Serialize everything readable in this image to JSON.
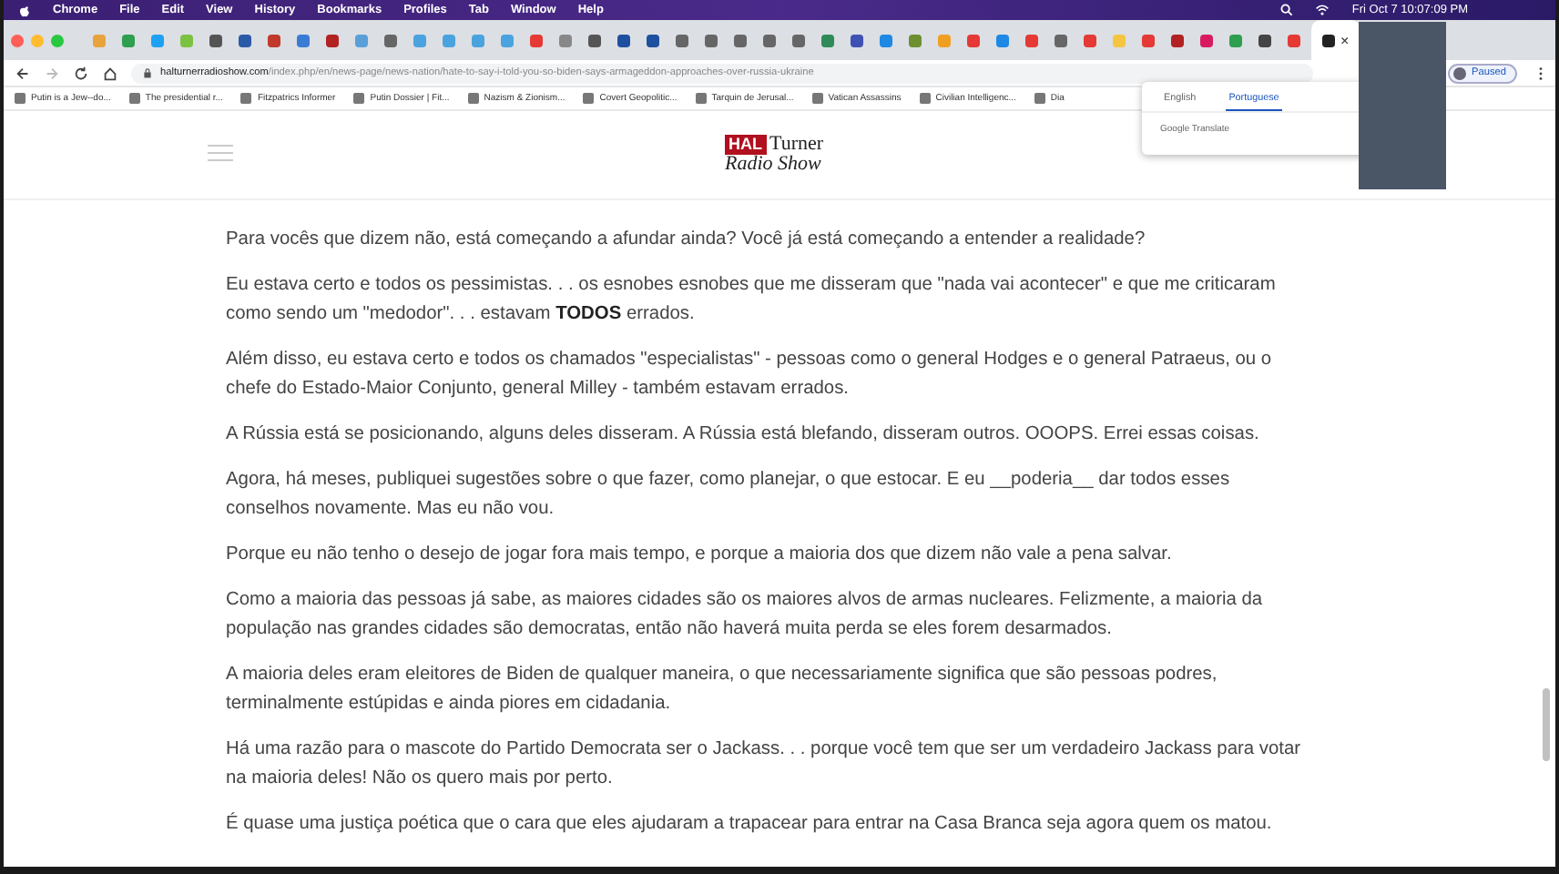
{
  "menu_bar": {
    "items": [
      "Chrome",
      "File",
      "Edit",
      "View",
      "History",
      "Bookmarks",
      "Profiles",
      "Tab",
      "Window",
      "Help"
    ],
    "clock": "Fri Oct 7  10:07:09 PM"
  },
  "tabs": [
    {
      "color": "#e8a33c",
      "selected": false
    },
    {
      "color": "#2e9e4f",
      "selected": false
    },
    {
      "color": "#1da1f2",
      "selected": false
    },
    {
      "color": "#7cc242",
      "selected": false
    },
    {
      "color": "#555555",
      "selected": false
    },
    {
      "color": "#2b5aa8",
      "selected": false
    },
    {
      "color": "#c0392b",
      "selected": false
    },
    {
      "color": "#3a7bd5",
      "selected": false
    },
    {
      "color": "#b22222",
      "selected": false
    },
    {
      "color": "#5aa0d8",
      "selected": false
    },
    {
      "color": "#666666",
      "selected": false
    },
    {
      "color": "#4aa3df",
      "selected": false
    },
    {
      "color": "#4aa3df",
      "selected": false
    },
    {
      "color": "#4aa3df",
      "selected": false
    },
    {
      "color": "#4aa3df",
      "selected": false
    },
    {
      "color": "#e53935",
      "selected": false
    },
    {
      "color": "#888888",
      "selected": false
    },
    {
      "color": "#555555",
      "selected": false
    },
    {
      "color": "#1e50a0",
      "selected": false
    },
    {
      "color": "#1e50a0",
      "selected": false
    },
    {
      "color": "#666666",
      "selected": false
    },
    {
      "color": "#666666",
      "selected": false
    },
    {
      "color": "#666666",
      "selected": false
    },
    {
      "color": "#666666",
      "selected": false
    },
    {
      "color": "#666666",
      "selected": false
    },
    {
      "color": "#2e8b57",
      "selected": false
    },
    {
      "color": "#3f51b5",
      "selected": false
    },
    {
      "color": "#1e88e5",
      "selected": false
    },
    {
      "color": "#6d8f2f",
      "selected": false
    },
    {
      "color": "#f0a020",
      "selected": false
    },
    {
      "color": "#e53935",
      "selected": false
    },
    {
      "color": "#1e88e5",
      "selected": false
    },
    {
      "color": "#e53935",
      "selected": false
    },
    {
      "color": "#666666",
      "selected": false
    },
    {
      "color": "#e53935",
      "selected": false
    },
    {
      "color": "#f5c542",
      "selected": false
    },
    {
      "color": "#e53935",
      "selected": false
    },
    {
      "color": "#b22222",
      "selected": false
    },
    {
      "color": "#d81b60",
      "selected": false
    },
    {
      "color": "#2e9e4f",
      "selected": false
    },
    {
      "color": "#444444",
      "selected": false
    },
    {
      "color": "#e53935",
      "selected": false
    },
    {
      "color": "#222222",
      "selected": true,
      "close": "×"
    }
  ],
  "address_bar": {
    "host": "halturnerradioshow.com",
    "path": "/index.php/en/news-page/news-nation/hate-to-say-i-told-you-so-biden-says-armageddon-approaches-over-russia-ukraine",
    "profile": "Paused"
  },
  "bookmarks": [
    "Putin is a Jew--do...",
    "The presidential r...",
    "Fitzpatrics Informer",
    "Putin Dossier | Fit...",
    "Nazism & Zionism...",
    "Covert Geopolitic...",
    "Tarquin de Jerusal...",
    "Vatican Assassins",
    "Civilian Intelligenc...",
    "Dia"
  ],
  "translate_popup": {
    "tabs": [
      {
        "label": "English",
        "selected": false
      },
      {
        "label": "Portuguese",
        "selected": true
      }
    ],
    "footer": "Google Translate"
  },
  "logo": {
    "badge": "HAL",
    "name": "Turner",
    "subtitle": "Radio Show"
  },
  "paragraphs": [
    "Para vocês que dizem não, está começando a afundar ainda? Você já está começando a entender a realidade?",
    "Eu estava certo e todos os pessimistas. . . os esnobes esnobes que me disseram que \"nada vai acontecer\" e que me criticaram como sendo um \"medodor\". . . estavam **TODOS** errados.",
    "Além disso, eu estava certo e todos os chamados \"especialistas\" - pessoas como o general Hodges e o general Patraeus, ou o chefe do Estado-Maior Conjunto, general Milley - também estavam errados.",
    "A Rússia está se posicionando, alguns deles disseram. A Rússia está blefando, disseram outros. OOOPS. Errei essas coisas.",
    "Agora, há meses, publiquei sugestões sobre o que fazer, como planejar, o que estocar. E eu __poderia__ dar todos esses conselhos novamente. Mas eu não vou.",
    "Porque eu não tenho o desejo de jogar fora mais tempo, e porque a maioria dos que dizem não vale a pena salvar.",
    "Como a maioria das pessoas já sabe, as maiores cidades são os maiores alvos de armas nucleares. Felizmente, a maioria da população nas grandes cidades são democratas, então não haverá muita perda se eles forem desarmados.",
    "A maioria deles eram eleitores de Biden de qualquer maneira, o que necessariamente significa que são pessoas podres, terminalmente estúpidas e ainda piores em cidadania.",
    "Há uma razão para o mascote do Partido Democrata ser o Jackass. . . porque você tem que ser um verdadeiro Jackass para votar na maioria deles! Não os quero mais por perto.",
    "É quase uma justiça poética que o cara que eles ajudaram a trapacear para entrar na Casa Branca seja agora quem os matou."
  ]
}
